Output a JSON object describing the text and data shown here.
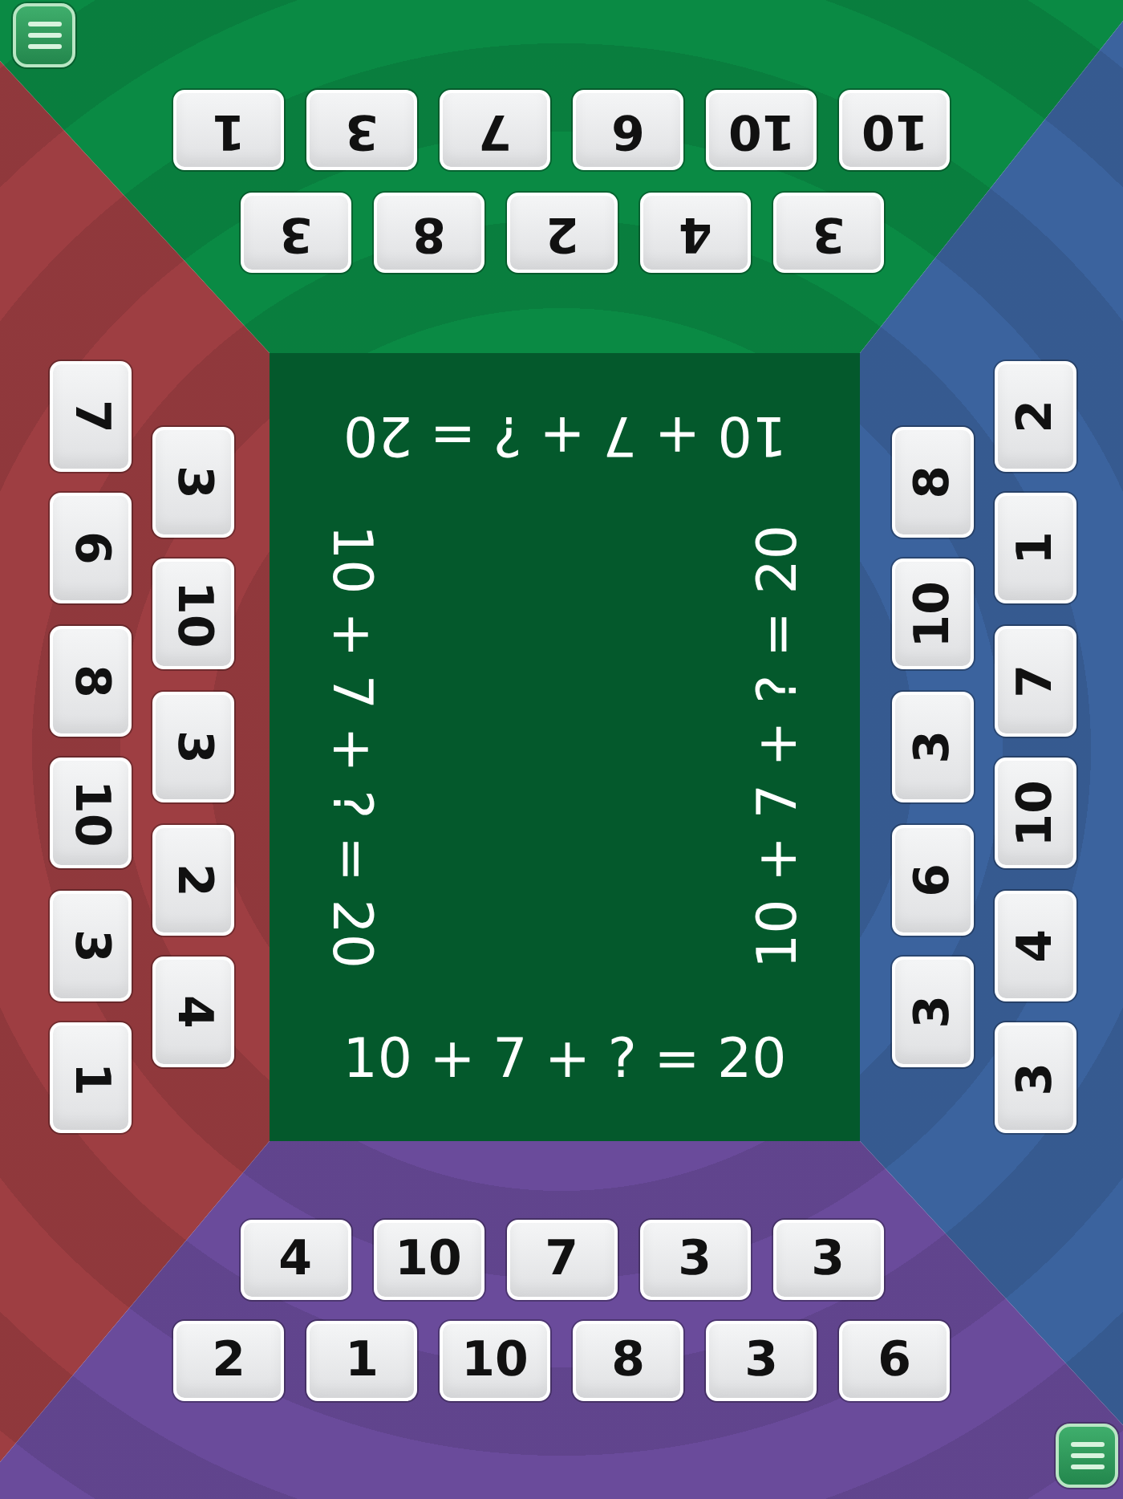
{
  "players": [
    {
      "kind": "top",
      "color": "#0a8a44",
      "rows": [
        [
          "1",
          "3",
          "7",
          "6",
          "10",
          "10"
        ],
        [
          "3",
          "8",
          "2",
          "4",
          "3"
        ]
      ]
    },
    {
      "kind": "left",
      "color": "#9e3e42",
      "columns": [
        [
          "7",
          "6",
          "8",
          "10",
          "3",
          "1"
        ],
        [
          "3",
          "10",
          "3",
          "2",
          "4"
        ]
      ]
    },
    {
      "kind": "right",
      "color": "#3b639e",
      "columns": [
        [
          "8",
          "10",
          "3",
          "6",
          "3"
        ],
        [
          "2",
          "1",
          "7",
          "10",
          "4",
          "3"
        ]
      ]
    },
    {
      "kind": "bottom",
      "color": "#6a4b9b",
      "rows": [
        [
          "4",
          "10",
          "7",
          "3",
          "3"
        ],
        [
          "2",
          "1",
          "10",
          "8",
          "3",
          "6"
        ]
      ]
    }
  ],
  "board": {
    "equations": [
      {
        "kind": "top",
        "text": "10 + 7 + ? = 20"
      },
      {
        "kind": "left",
        "text": "10 + 7 + ? = 20"
      },
      {
        "kind": "right",
        "text": "10 + 7 + ? = 20"
      },
      {
        "kind": "bottom",
        "text": "10 + 7 + ? = 20"
      }
    ]
  }
}
